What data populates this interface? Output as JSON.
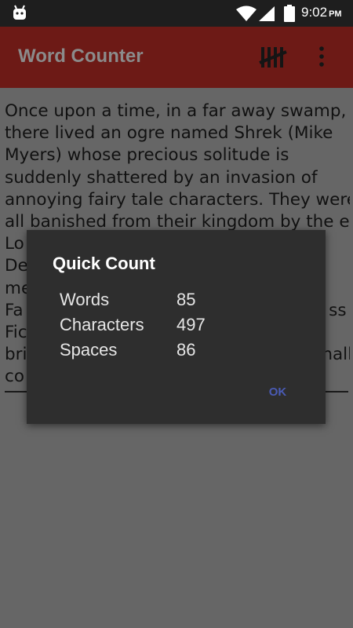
{
  "status_bar": {
    "time": "9:02",
    "ampm": "PM",
    "icons": [
      "android-icon",
      "wifi-icon",
      "signal-icon",
      "battery-icon"
    ]
  },
  "app_bar": {
    "title": "Word Counter",
    "background_color": "#6d1a16",
    "icons": [
      "tally-marks-icon",
      "more-vert-icon"
    ]
  },
  "editor": {
    "lines": [
      "Once upon a time, in a far away swamp,",
      "there lived an ogre named Shrek (Mike",
      "Myers) whose precious solitude is",
      "suddenly shattered by an invasion of",
      "annoying fairy tale characters. They were",
      "all banished from their kingdom by the evil",
      "Lo",
      "De",
      "me",
      "Fa                                                         ss",
      "Fic",
      "bri                                                       hall",
      "co"
    ]
  },
  "dialog": {
    "title": "Quick Count",
    "stats": [
      {
        "label": "Words",
        "value": "85"
      },
      {
        "label": "Characters",
        "value": "497"
      },
      {
        "label": "Spaces",
        "value": "86"
      }
    ],
    "ok_label": "OK",
    "ok_color": "#4a5bb5"
  }
}
